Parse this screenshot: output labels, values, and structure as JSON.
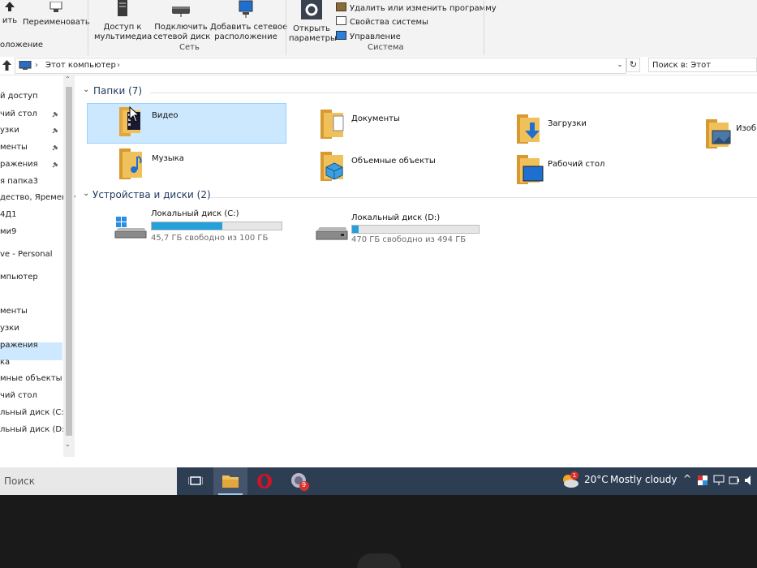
{
  "ribbon": {
    "partial_label_1": "ить",
    "rename": "Переименовать",
    "partial_label_2": "оложение",
    "media_access_line1": "Доступ к",
    "media_access_line2": "мультимедиа",
    "map_drive_line1": "Подключить",
    "map_drive_line2": "сетевой диск",
    "add_location_line1": "Добавить сетевое",
    "add_location_line2": "расположение",
    "group_network": "Сеть",
    "open_settings_line1": "Открыть",
    "open_settings_line2": "параметры",
    "uninstall": "Удалить или изменить программу",
    "system_properties": "Свойства системы",
    "manage": "Управление",
    "group_system": "Система"
  },
  "address": {
    "path": "Этот компьютер",
    "search_placeholder": "Поиск в: Этот компьютер"
  },
  "nav": {
    "items": [
      "й доступ",
      "чий стол",
      "узки",
      "менты",
      "ражения",
      "я папка3",
      "дество, Яременки",
      "4Д1",
      "ми9",
      "ve - Personal",
      "мпьютер",
      "",
      "менты",
      "узки",
      "ражения",
      "ка",
      "мные объекты",
      "чий стол",
      "льный диск (C:)",
      "льный диск (D:)"
    ]
  },
  "folders": {
    "header": "Папки (7)",
    "items": [
      {
        "label": "Видео",
        "icon": "video-folder-icon"
      },
      {
        "label": "Документы",
        "icon": "documents-folder-icon"
      },
      {
        "label": "Загрузки",
        "icon": "downloads-folder-icon"
      },
      {
        "label": "Изобр",
        "icon": "pictures-folder-icon"
      },
      {
        "label": "Музыка",
        "icon": "music-folder-icon"
      },
      {
        "label": "Объемные объекты",
        "icon": "3d-objects-folder-icon"
      },
      {
        "label": "Рабочий стол",
        "icon": "desktop-folder-icon"
      }
    ]
  },
  "drives": {
    "header": "Устройства и диски (2)",
    "items": [
      {
        "name": "Локальный диск (C:)",
        "free": "45,7 ГБ свободно из 100 ГБ",
        "used_fraction": 0.543,
        "icon": "windows-drive-icon"
      },
      {
        "name": "Локальный диск (D:)",
        "free": "470 ГБ свободно из 494 ГБ",
        "used_fraction": 0.049,
        "icon": "drive-icon"
      }
    ]
  },
  "taskbar": {
    "search": "Поиск",
    "weather_badge": "1",
    "temperature": "20°C",
    "weather": "Mostly cloudy",
    "app_badge": "9"
  },
  "colors": {
    "accent": "#26a0da",
    "selection": "#cce8ff",
    "taskbar": "#2d3d52",
    "opera_red": "#d01327"
  }
}
